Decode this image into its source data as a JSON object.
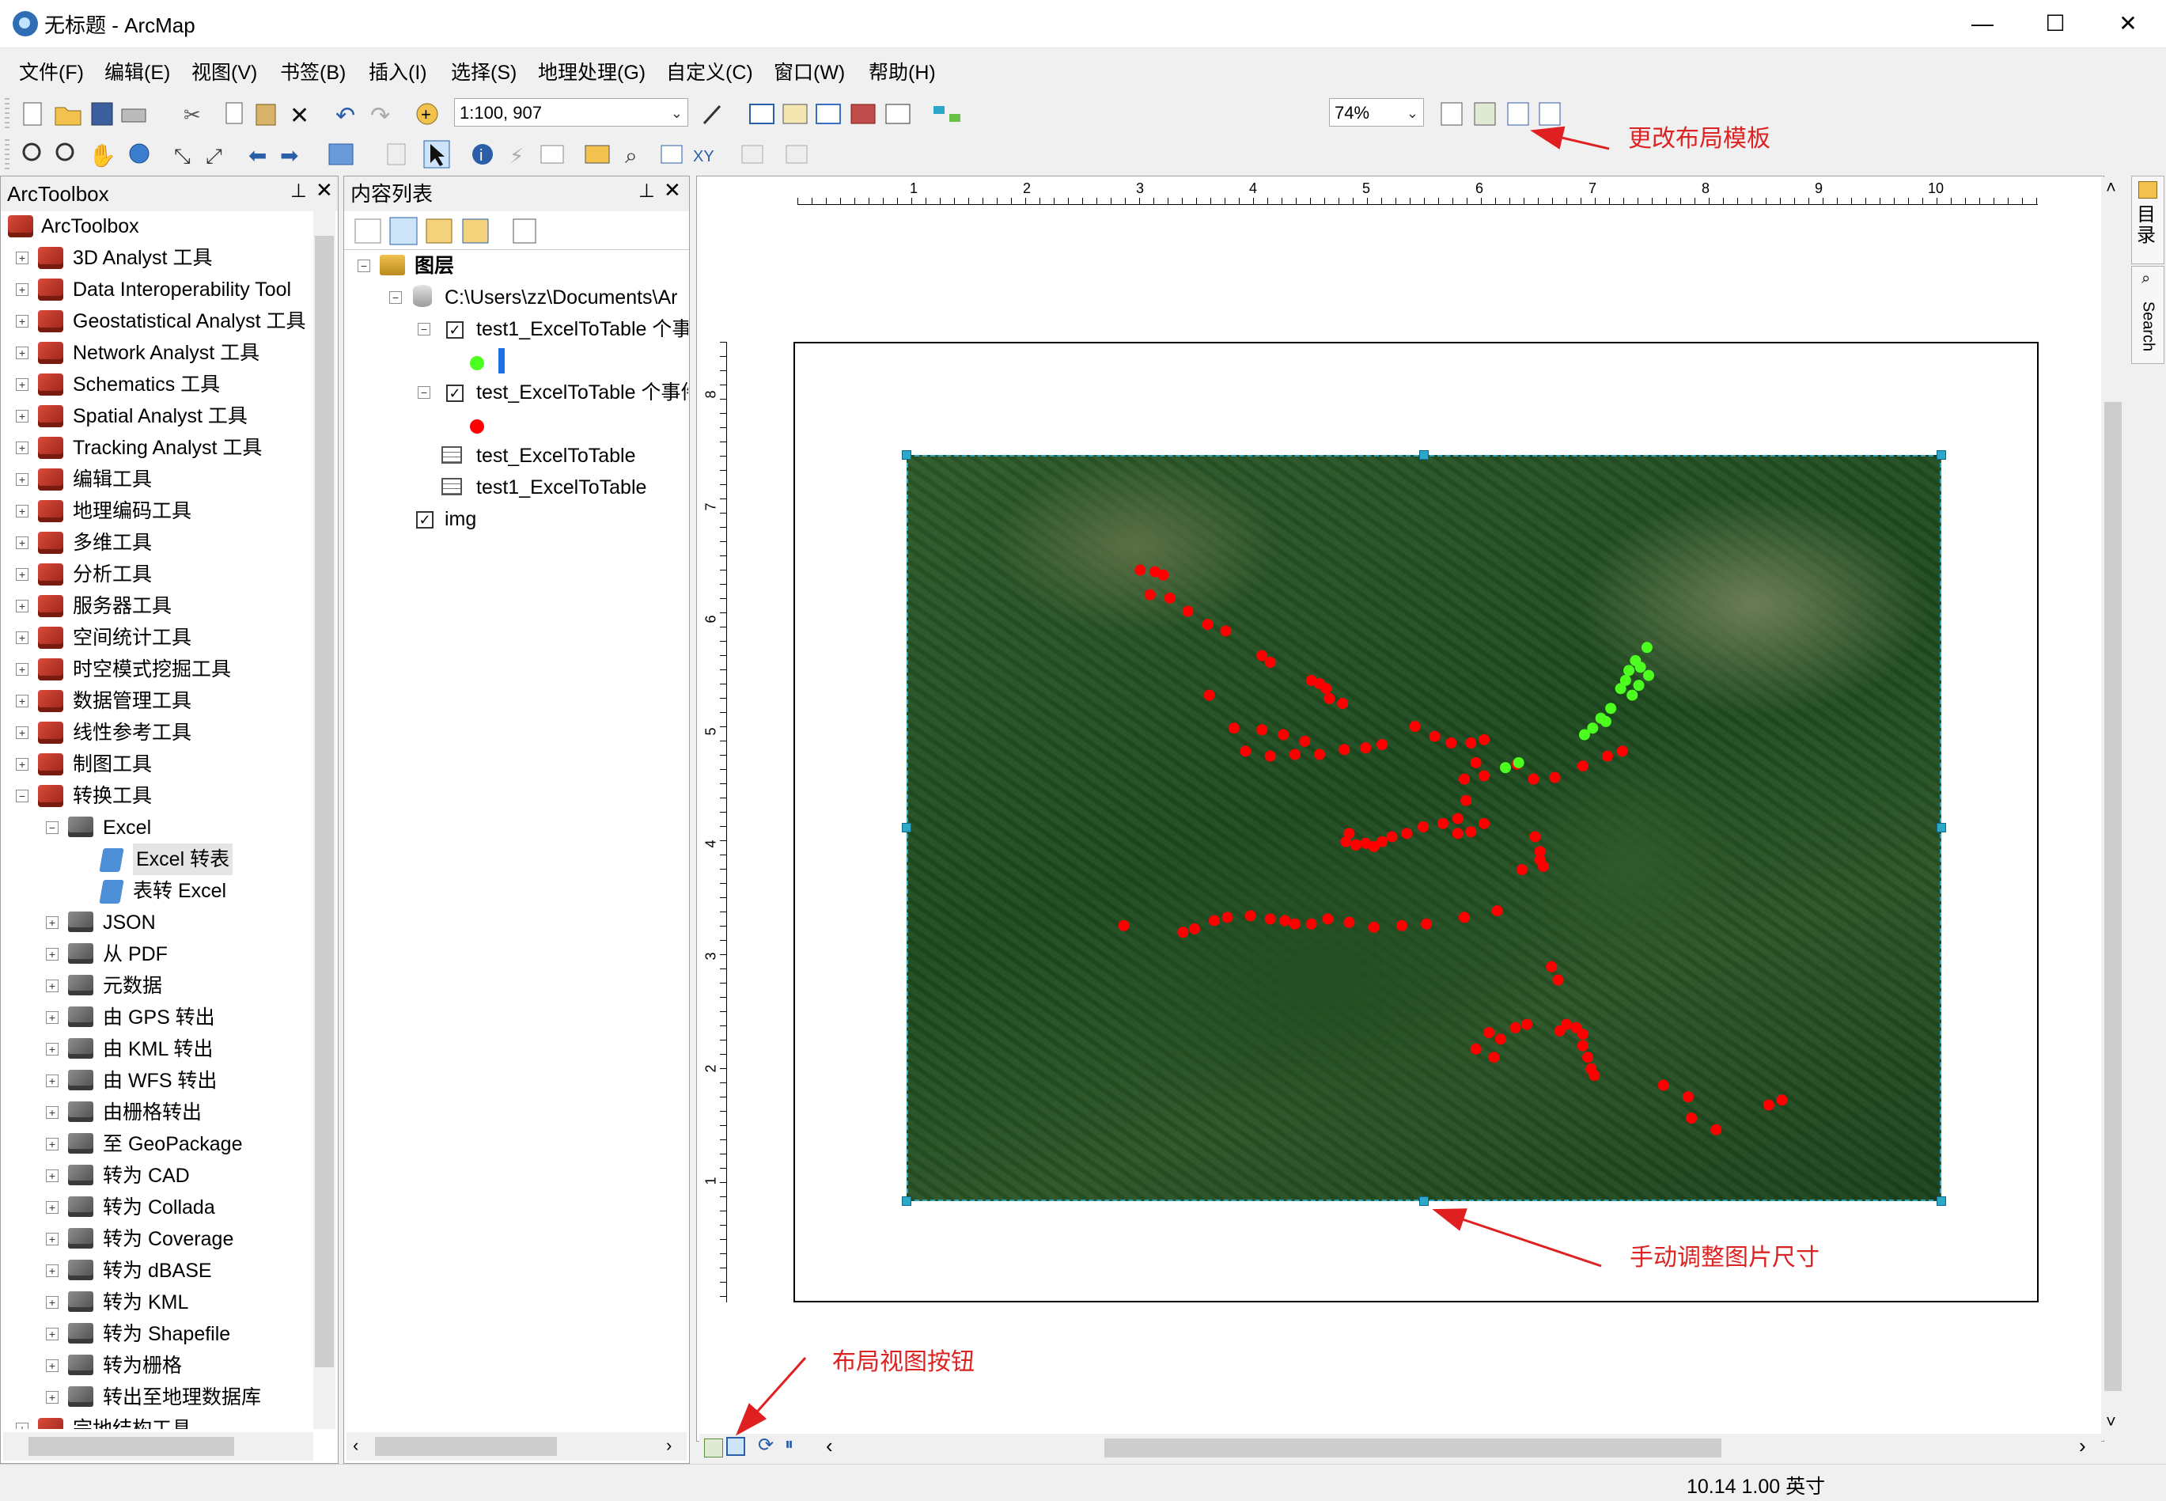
{
  "window": {
    "title": "无标题 - ArcMap",
    "minimize": "—",
    "maximize": "☐",
    "close": "✕"
  },
  "menu": [
    "文件(F)",
    "编辑(E)",
    "视图(V)",
    "书签(B)",
    "插入(I)",
    "选择(S)",
    "地理处理(G)",
    "自定义(C)",
    "窗口(W)",
    "帮助(H)"
  ],
  "toolbar": {
    "scale_value": "1:100, 907",
    "zoom_value": "74%"
  },
  "arctoolbox": {
    "title": "ArcToolbox",
    "root": "ArcToolbox",
    "items": [
      "3D Analyst 工具",
      "Data Interoperability Tool",
      "Geostatistical Analyst 工具",
      "Network Analyst 工具",
      "Schematics 工具",
      "Spatial Analyst 工具",
      "Tracking Analyst 工具",
      "编辑工具",
      "地理编码工具",
      "多维工具",
      "分析工具",
      "服务器工具",
      "空间统计工具",
      "时空模式挖掘工具",
      "数据管理工具",
      "线性参考工具",
      "制图工具",
      "转换工具"
    ],
    "excel_group": "Excel",
    "excel_tools": [
      "Excel 转表",
      "表转 Excel"
    ],
    "conversion_toolsets": [
      "JSON",
      "从 PDF",
      "元数据",
      "由 GPS 转出",
      "由 KML 转出",
      "由 WFS 转出",
      "由栅格转出",
      "至 GeoPackage",
      "转为 CAD",
      "转为 Collada",
      "转为 Coverage",
      "转为 dBASE",
      "转为 KML",
      "转为 Shapefile",
      "转为栅格",
      "转出至地理数据库"
    ],
    "last_item": "宗地结构工具"
  },
  "toc": {
    "title": "内容列表",
    "layers_root": "图层",
    "path": "C:\\Users\\zz\\Documents\\Ar",
    "layer1": "test1_ExcelToTable 个事",
    "layer2": "test_ExcelToTable 个事件",
    "table1": "test_ExcelToTable",
    "table2": "test1_ExcelToTable",
    "img": "img",
    "colors": {
      "green": "#4cff1f",
      "red": "#ff0000"
    }
  },
  "ruler": {
    "h_ticks": [
      "1",
      "2",
      "3",
      "4",
      "5",
      "6",
      "7",
      "8",
      "9",
      "10"
    ],
    "v_ticks": [
      "8",
      "7",
      "6",
      "5",
      "4",
      "3",
      "2",
      "1"
    ]
  },
  "annotations": {
    "layout_template": "更改布局模板",
    "resize_image": "手动调整图片尺寸",
    "layout_view_button": "布局视图按钮"
  },
  "side_tabs": {
    "catalog": "目录",
    "search": "Search"
  },
  "status": {
    "coords": "10.14  1.00 英寸"
  }
}
